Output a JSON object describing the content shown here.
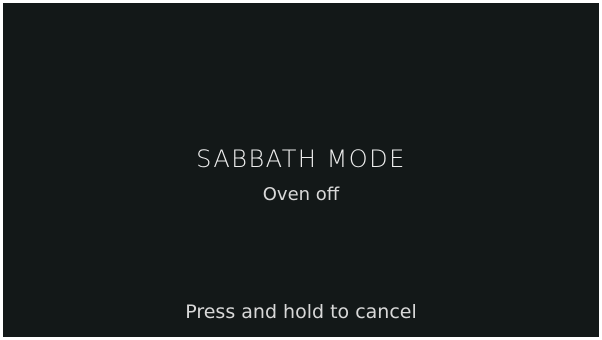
{
  "screen": {
    "title": "SABBATH MODE",
    "status": "Oven off",
    "cancel_hint": "Press and hold to cancel"
  },
  "colors": {
    "background": "#131818",
    "text": "#e6e6e6"
  }
}
